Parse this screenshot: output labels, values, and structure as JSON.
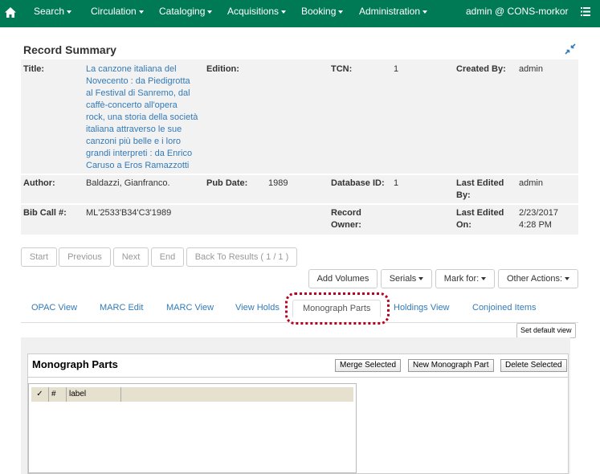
{
  "nav": {
    "items": [
      "Search",
      "Circulation",
      "Cataloging",
      "Acquisitions",
      "Booking",
      "Administration"
    ],
    "user": "admin @ CONS-morkor"
  },
  "record_summary": {
    "heading": "Record Summary",
    "title_label": "Title:",
    "title_lines": [
      "La canzone italiana del",
      "Novecento : da Piedigrotta",
      "al Festival di Sanremo, dal",
      "caffè-concerto all'opera",
      "rock, una storia della società",
      "italiana attraverso le sue",
      "canzoni più belle e i loro",
      "grandi interpreti : da Enrico",
      "Caruso a Eros Ramazzotti"
    ],
    "edition_label": "Edition:",
    "edition_value": "",
    "tcn_label": "TCN:",
    "tcn_value": "1",
    "created_by_label": "Created By:",
    "created_by_value": "admin",
    "author_label": "Author:",
    "author_value": "Baldazzi, Gianfranco.",
    "pub_date_label": "Pub Date:",
    "pub_date_value": "1989",
    "database_id_label": "Database ID:",
    "database_id_value": "1",
    "last_edited_by_label_1": "Last Edited",
    "last_edited_by_label_2": "By:",
    "last_edited_by_value": "admin",
    "bib_call_label": "Bib Call #:",
    "bib_call_value": "ML'2533'B34'C3'1989",
    "record_owner_label_1": "Record",
    "record_owner_label_2": "Owner:",
    "record_owner_value": "",
    "last_edited_on_label_1": "Last Edited",
    "last_edited_on_label_2": "On:",
    "last_edited_on_value_1": "2/23/2017",
    "last_edited_on_value_2": "4:28 PM"
  },
  "pager": {
    "start": "Start",
    "previous": "Previous",
    "next": "Next",
    "end": "End",
    "back": "Back To Results ( 1 / 1 )"
  },
  "actions": {
    "add_volumes": "Add Volumes",
    "serials": "Serials",
    "mark_for": "Mark for:",
    "other_actions": "Other Actions:"
  },
  "tabs": [
    "OPAC View",
    "MARC Edit",
    "MARC View",
    "View Holds",
    "Monograph Parts",
    "Holdings View",
    "Conjoined Items"
  ],
  "active_tab": "Monograph Parts",
  "set_default_view": "Set default view",
  "monograph_parts": {
    "title": "Monograph Parts",
    "merge_selected": "Merge Selected",
    "new_part": "New Monograph Part",
    "delete_selected": "Delete Selected",
    "columns": [
      "✓",
      "#",
      "label"
    ]
  },
  "colors": {
    "navbar": "#007a54",
    "link": "#337ab7",
    "highlight": "#b8001f"
  }
}
